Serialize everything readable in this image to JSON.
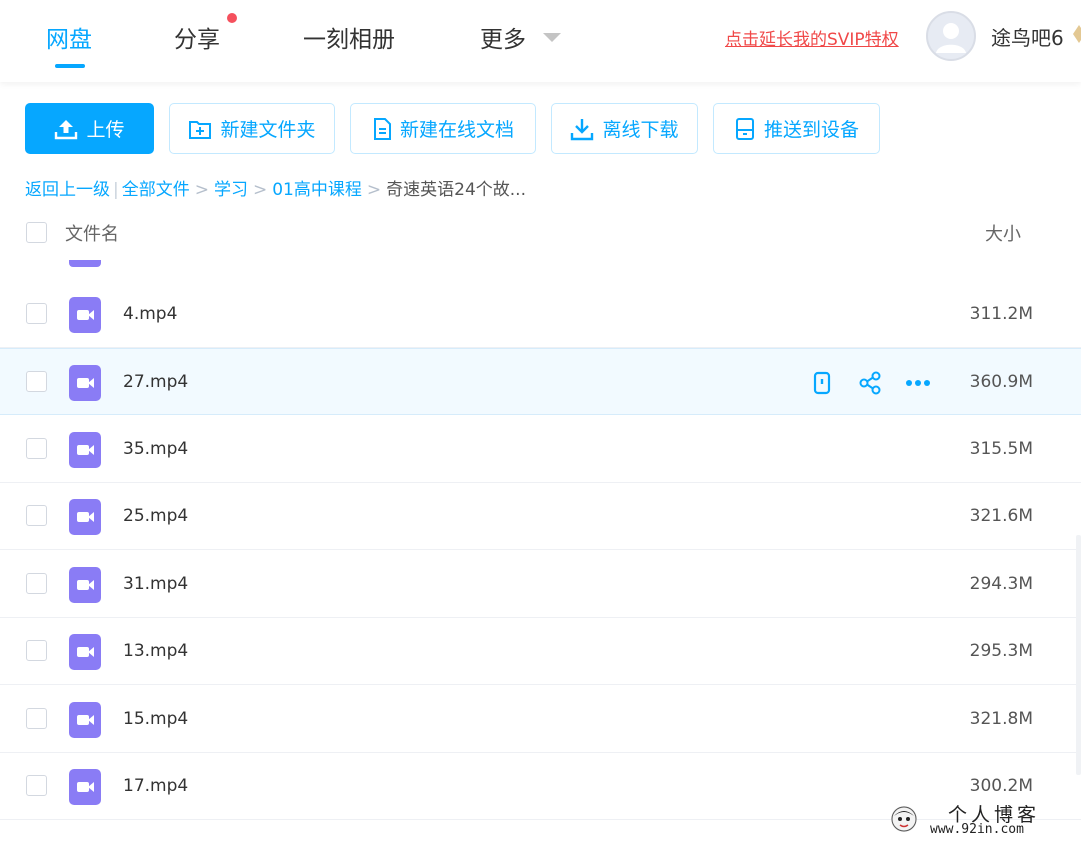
{
  "nav": {
    "tabs": [
      {
        "label": "网盘",
        "active": true
      },
      {
        "label": "分享"
      },
      {
        "label": "一刻相册"
      },
      {
        "label": "更多"
      }
    ],
    "svip_link": "点击延长我的SVIP特权",
    "username": "途鸟吧6"
  },
  "toolbar": {
    "upload": "上传",
    "new_folder": "新建文件夹",
    "new_doc": "新建在线文档",
    "offline_download": "离线下载",
    "push_device": "推送到设备"
  },
  "breadcrumb": {
    "back": "返回上一级",
    "all_files": "全部文件",
    "path": [
      "学习",
      "01高中课程"
    ],
    "current": "奇速英语24个故..."
  },
  "table": {
    "col_name": "文件名",
    "col_size": "大小",
    "rows": [
      {
        "name": "4.mp4",
        "size": "311.2M"
      },
      {
        "name": "27.mp4",
        "size": "360.9M",
        "hover": true
      },
      {
        "name": "35.mp4",
        "size": "315.5M"
      },
      {
        "name": "25.mp4",
        "size": "321.6M"
      },
      {
        "name": "31.mp4",
        "size": "294.3M"
      },
      {
        "name": "13.mp4",
        "size": "295.3M"
      },
      {
        "name": "15.mp4",
        "size": "321.8M"
      },
      {
        "name": "17.mp4",
        "size": "300.2M"
      }
    ]
  },
  "watermark": {
    "line1": "个人博客",
    "line2": "www.92in.com"
  },
  "colors": {
    "accent": "#06a7ff",
    "video_icon": "#8a7cf5",
    "svip": "#f04848"
  }
}
